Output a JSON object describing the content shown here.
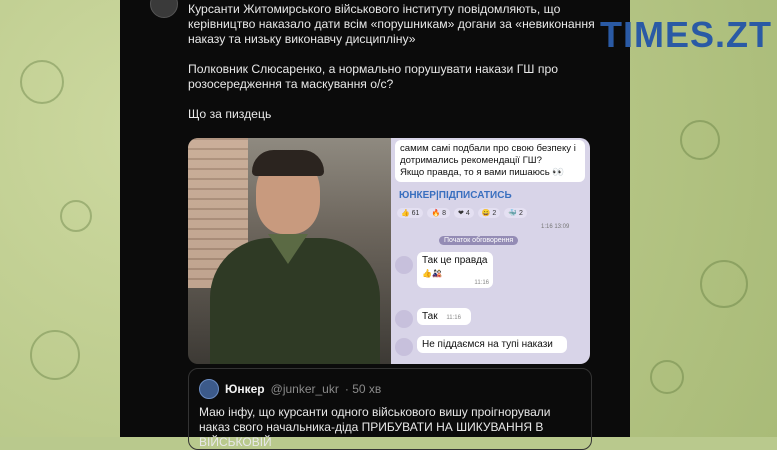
{
  "site_logo": "TIMES.ZT",
  "post": {
    "paragraphs": [
      "Курсанти Житомирського військового інституту повідомляють, що керівництво наказало дати всім «порушникам» догани за «невиконання наказу та низьку виконавчу дисципліну»",
      "Полковник Слюсаренко, а нормально порушувати накази ГШ про розосередження та маскування о/с?",
      "Що за пиздець"
    ]
  },
  "screenshot": {
    "message_text": "самим самі подбали про свою безпеку і дотримались рекомендації ГШ?\nЯкщо правда, то я вами пишаюсь 👀",
    "channel_link": "ЮНКЕР|ПІДПИСАТИСЬ",
    "reactions": [
      "👍 61",
      "🔥 8",
      "❤ 4",
      "😄 2",
      "🐳 2"
    ],
    "time": "1:16 13:09",
    "divider": "Початок обговорення",
    "chat": [
      {
        "text": "Так це правда",
        "time": "11:16"
      },
      {
        "text": "Так",
        "time": "11:16"
      },
      {
        "text": "Не піддаємся на тупі накази",
        "time": ""
      }
    ]
  },
  "quote": {
    "name": "Юнкер",
    "handle": "@junker_ukr",
    "age": "· 50 хв",
    "text": "Маю інфу, що курсанти одного військового вишу проігнорували наказ свого начальника-діда ПРИБУВАТИ НА ШИКУВАННЯ В ВІЙСЬКОВІЙ"
  }
}
